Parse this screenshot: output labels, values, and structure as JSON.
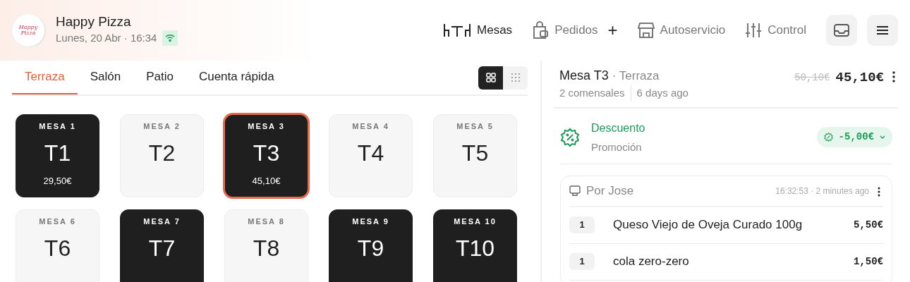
{
  "header": {
    "logo_text": "Happy Pizza",
    "title": "Happy Pizza",
    "subtitle": "Lunes, 20 Abr · 16:34",
    "online": true
  },
  "nav": [
    {
      "label": "Mesas",
      "kind": "tables",
      "selected": true
    },
    {
      "label": "Pedidos",
      "kind": "bag",
      "selected": false,
      "add": "+"
    },
    {
      "label": "Autoservicio",
      "kind": "store",
      "selected": false
    },
    {
      "label": "Control",
      "kind": "sliders",
      "selected": false
    }
  ],
  "tabs": [
    {
      "label": "Terraza",
      "selected": true
    },
    {
      "label": "Salón",
      "selected": false
    },
    {
      "label": "Patio",
      "selected": false
    },
    {
      "label": "Cuenta rápida",
      "selected": false
    }
  ],
  "view_toggle": [
    {
      "kind": "grid",
      "selected": true
    },
    {
      "kind": "dots",
      "selected": false
    }
  ],
  "tables": [
    {
      "label": "MESA 1",
      "name": "T1",
      "amount": "29,50€",
      "occupied": true,
      "selected": false
    },
    {
      "label": "MESA 2",
      "name": "T2",
      "occupied": false,
      "selected": false
    },
    {
      "label": "MESA 3",
      "name": "T3",
      "amount": "45,10€",
      "occupied": true,
      "selected": true
    },
    {
      "label": "MESA 4",
      "name": "T4",
      "occupied": false,
      "selected": false
    },
    {
      "label": "MESA 5",
      "name": "T5",
      "occupied": false,
      "selected": false
    },
    {
      "label": "MESA 6",
      "name": "T6",
      "occupied": false,
      "selected": false
    },
    {
      "label": "MESA 7",
      "name": "T7",
      "occupied": true,
      "selected": false
    },
    {
      "label": "MESA 8",
      "name": "T8",
      "occupied": false,
      "selected": false
    },
    {
      "label": "MESA 9",
      "name": "T9",
      "occupied": true,
      "selected": false
    },
    {
      "label": "MESA 10",
      "name": "T10",
      "occupied": true,
      "selected": false
    }
  ],
  "order": {
    "title": "Mesa T3",
    "area": "· Terraza",
    "guests": "2 comensales",
    "age": "6 days ago",
    "old_total": "50,10€",
    "total": "45,10€",
    "discount": {
      "title": "Descuento",
      "subtitle": "Promoción",
      "amount": "-5,00€"
    },
    "group": {
      "author": "Por Jose",
      "time": "16:32:53 · 2 minutes ago",
      "items": [
        {
          "qty": "1",
          "name": "Queso Viejo de Oveja Curado 100g",
          "price": "5,50€"
        },
        {
          "qty": "1",
          "name": "cola zero-zero",
          "price": "1,50€"
        }
      ]
    }
  }
}
